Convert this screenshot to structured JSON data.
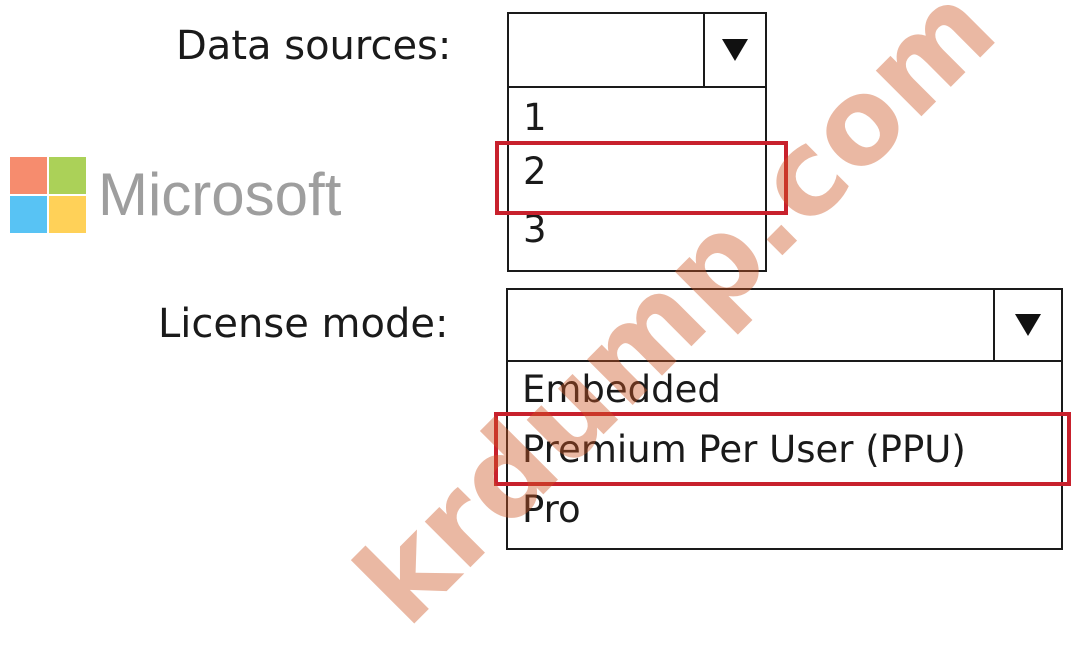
{
  "data_sources": {
    "label": "Data sources:",
    "selected": "",
    "options": [
      "1",
      "2",
      "3"
    ],
    "highlighted_option": "2"
  },
  "license_mode": {
    "label": "License mode:",
    "selected": "",
    "options": [
      "Embedded",
      "Premium Per User (PPU)",
      "Pro"
    ],
    "highlighted_option": "Premium Per User (PPU)"
  },
  "logo": {
    "text": "Microsoft",
    "colors": [
      "#f25022",
      "#7fba00",
      "#00a4ef",
      "#ffb900"
    ]
  },
  "watermark": {
    "text": "krdump.com"
  },
  "colors": {
    "highlight": "#c8212d",
    "border": "#1a1a1a"
  }
}
